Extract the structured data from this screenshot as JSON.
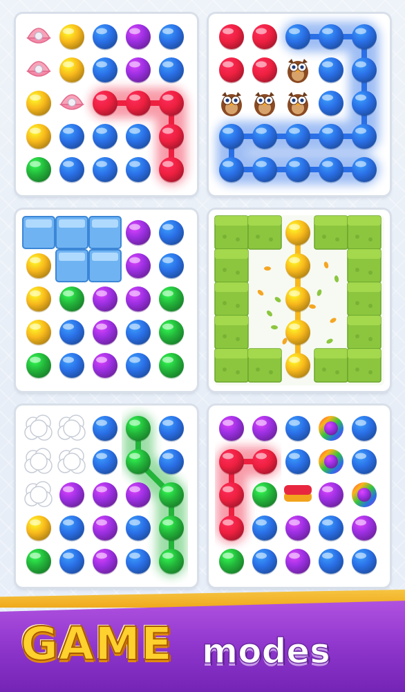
{
  "banner": {
    "title_big": "GAME",
    "title_small": "modes"
  },
  "colors": {
    "red": "#ee2040",
    "blue": "#2a6fe6",
    "purple": "#9a2fe0",
    "yellow": "#f8b81c",
    "green": "#23b43a",
    "bg_panel": "#ffffff"
  },
  "panels": [
    {
      "id": "pearl-mode",
      "grid": [
        [
          "pearl",
          "yellow",
          "blue",
          "purple",
          "blue"
        ],
        [
          "pearl",
          "yellow",
          "blue",
          "purple",
          "blue"
        ],
        [
          "yellow",
          "pearl",
          "red",
          "red",
          "red"
        ],
        [
          "yellow",
          "blue",
          "blue",
          "blue",
          "red"
        ],
        [
          "green",
          "blue",
          "blue",
          "blue",
          "red"
        ]
      ],
      "path_color": "red",
      "path": [
        [
          2,
          2
        ],
        [
          2,
          3
        ],
        [
          2,
          4
        ],
        [
          3,
          4
        ],
        [
          4,
          4
        ]
      ]
    },
    {
      "id": "owl-mode",
      "grid": [
        [
          "red",
          "red",
          "blue",
          "blue",
          "blue"
        ],
        [
          "red",
          "red",
          "owl",
          "blue",
          "blue"
        ],
        [
          "owl",
          "owl",
          "owl",
          "blue",
          "blue"
        ],
        [
          "blue",
          "blue",
          "blue",
          "blue",
          "blue"
        ],
        [
          "blue",
          "blue",
          "blue",
          "blue",
          "blue"
        ]
      ],
      "path_color": "blue",
      "path": [
        [
          0,
          2
        ],
        [
          0,
          3
        ],
        [
          0,
          4
        ],
        [
          1,
          4
        ],
        [
          2,
          4
        ],
        [
          3,
          4
        ],
        [
          3,
          3
        ],
        [
          3,
          2
        ],
        [
          3,
          1
        ],
        [
          3,
          0
        ],
        [
          4,
          0
        ],
        [
          4,
          1
        ],
        [
          4,
          2
        ],
        [
          4,
          3
        ],
        [
          4,
          4
        ]
      ]
    },
    {
      "id": "ice-mode",
      "grid": [
        [
          "ice",
          "ice",
          "ice",
          "purple",
          "blue"
        ],
        [
          "yellow",
          "ice",
          "ice",
          "purple",
          "blue"
        ],
        [
          "yellow",
          "green",
          "purple",
          "purple",
          "green"
        ],
        [
          "yellow",
          "blue",
          "purple",
          "blue",
          "green"
        ],
        [
          "green",
          "blue",
          "purple",
          "blue",
          "green"
        ]
      ],
      "path_color": "",
      "path": []
    },
    {
      "id": "hedge-mode",
      "grid": [
        [
          "hedge",
          "hedge",
          "yellow",
          "hedge",
          "hedge"
        ],
        [
          "hedge",
          "empty",
          "yellow",
          "empty",
          "hedge"
        ],
        [
          "hedge",
          "empty",
          "yellow",
          "empty",
          "hedge"
        ],
        [
          "hedge",
          "empty",
          "yellow",
          "empty",
          "hedge"
        ],
        [
          "hedge",
          "hedge",
          "yellow",
          "hedge",
          "hedge"
        ]
      ],
      "path_color": "yellow",
      "path": [
        [
          0,
          2
        ],
        [
          1,
          2
        ],
        [
          2,
          2
        ],
        [
          3,
          2
        ],
        [
          4,
          2
        ]
      ]
    },
    {
      "id": "cloud-mode",
      "grid": [
        [
          "cloud",
          "cloud",
          "blue",
          "green",
          "blue"
        ],
        [
          "cloud",
          "cloud",
          "blue",
          "green",
          "blue"
        ],
        [
          "cloud",
          "purple",
          "purple",
          "purple",
          "green"
        ],
        [
          "yellow",
          "blue",
          "purple",
          "blue",
          "green"
        ],
        [
          "green",
          "blue",
          "purple",
          "blue",
          "green"
        ]
      ],
      "path_color": "green",
      "path": [
        [
          0,
          3
        ],
        [
          1,
          3
        ],
        [
          2,
          4
        ],
        [
          3,
          4
        ],
        [
          4,
          4
        ]
      ]
    },
    {
      "id": "sponge-mode",
      "grid": [
        [
          "purple",
          "purple",
          "blue",
          "rainbow",
          "blue"
        ],
        [
          "red",
          "red",
          "blue",
          "rainbow",
          "blue"
        ],
        [
          "red",
          "green",
          "sponge",
          "purple",
          "rainbow"
        ],
        [
          "red",
          "blue",
          "purple",
          "blue",
          "purple"
        ],
        [
          "green",
          "blue",
          "purple",
          "blue",
          "blue"
        ]
      ],
      "path_color": "red",
      "path": [
        [
          1,
          1
        ],
        [
          1,
          0
        ],
        [
          2,
          0
        ],
        [
          3,
          0
        ]
      ]
    }
  ]
}
